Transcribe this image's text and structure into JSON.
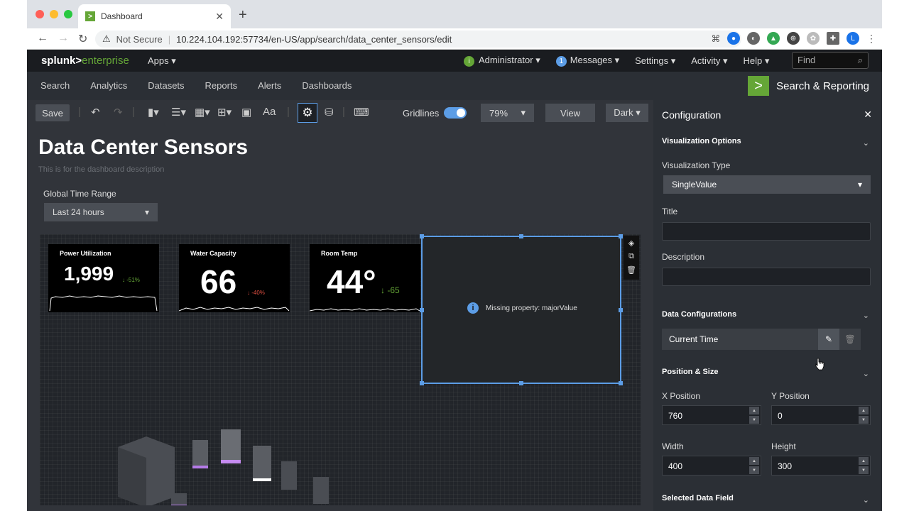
{
  "browser": {
    "tab_title": "Dashboard",
    "favicon": ">",
    "security": "Not Secure",
    "url": "10.224.104.192:57734/en-US/app/search/data_center_sensors/edit",
    "profile_initial": "L"
  },
  "splunk_bar": {
    "logo_prefix": "splunk>",
    "logo_suffix": "enterprise",
    "apps": "Apps ▾",
    "admin": "Administrator ▾",
    "messages_count": "1",
    "messages": "Messages ▾",
    "settings": "Settings ▾",
    "activity": "Activity ▾",
    "help": "Help ▾",
    "find_placeholder": "Find"
  },
  "app_bar": {
    "nav": [
      "Search",
      "Analytics",
      "Datasets",
      "Reports",
      "Alerts",
      "Dashboards"
    ],
    "app_name": "Search & Reporting"
  },
  "toolbar": {
    "save": "Save",
    "gridlines": "Gridlines",
    "zoom": "79%",
    "view": "View",
    "theme": "Dark ▾",
    "text_tool": "Aa"
  },
  "dashboard": {
    "title": "Data Center Sensors",
    "description": "This is for the dashboard description",
    "time_label": "Global Time Range",
    "time_value": "Last 24 hours",
    "single_values": [
      {
        "title": "Power Utilization",
        "value": "1,999",
        "delta": "↓ -51%",
        "delta_color": "#65a637"
      },
      {
        "title": "Water Capacity",
        "value": "66",
        "delta": "↓ -40%",
        "delta_color": "#dc4e41"
      },
      {
        "title": "Room Temp",
        "value": "44°",
        "delta": "↓ -65",
        "delta_color": "#65a637"
      }
    ],
    "missing_message": "Missing property: majorValue"
  },
  "config": {
    "title": "Configuration",
    "viz_options": "Visualization Options",
    "viz_type_label": "Visualization Type",
    "viz_type_value": "SingleValue",
    "title_label": "Title",
    "description_label": "Description",
    "data_configs": "Data Configurations",
    "data_config_item": "Current Time",
    "position_size": "Position & Size",
    "x_label": "X Position",
    "x_value": "760",
    "y_label": "Y Position",
    "y_value": "0",
    "width_label": "Width",
    "width_value": "400",
    "height_label": "Height",
    "height_value": "300",
    "selected_field": "Selected Data Field"
  },
  "colors": {
    "accent": "#5c9de6",
    "splunk_green": "#65a637",
    "panel_bg": "#2b2f35"
  }
}
